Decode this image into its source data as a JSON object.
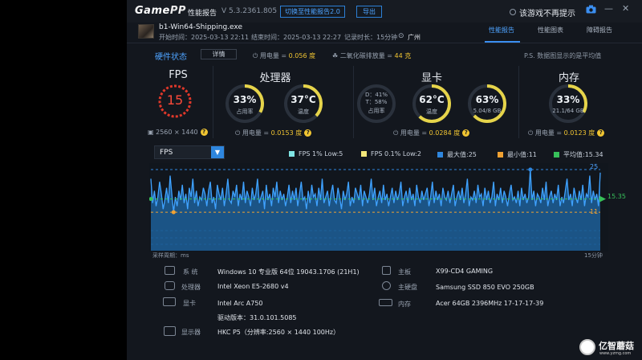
{
  "titlebar": {
    "logo_a": "Game",
    "logo_b": "PP",
    "title": "性能报告",
    "version": "V 5.3.2361.805",
    "switch_label": "切换至性能报告2.0",
    "export_label": "导出",
    "no_more_label": "该游戏不再提示"
  },
  "game": {
    "exe": "b1-Win64-Shipping.exe",
    "start": "开始时间：2025-03-13 22:11",
    "end": "结束时间：2025-03-13 22:27",
    "duration": "记录时长：15分钟",
    "location": "广州"
  },
  "tabs": [
    "性能报告",
    "性能图表",
    "障碍报告"
  ],
  "hw": {
    "title": "硬件状态",
    "detail_label": "详情",
    "power_label": "用电量 = ",
    "power_value": "0.056 度",
    "co2_label": "二氧化碳排放量 = ",
    "co2_value": "44 克",
    "ps": "P.S. 数据图显示的是平均值"
  },
  "fps_panel": {
    "title": "FPS",
    "value": "15",
    "resolution": "2560 × 1440"
  },
  "cpu_panel": {
    "title": "处理器",
    "usage_value": "33%",
    "usage_label": "占用率",
    "usage_pct": 33,
    "temp_value": "37°C",
    "temp_label": "温度",
    "temp_pct": 37,
    "power_label": "用电量 = ",
    "power_value": "0.0153 度"
  },
  "gpu_panel": {
    "title": "显卡",
    "d_label": "D：41%",
    "t_label": "T：58%",
    "usage_label": "占用率",
    "temp_value": "62°C",
    "temp_label": "温度",
    "temp_pct": 62,
    "vram_value": "63%",
    "vram_label": "5.04/8 GB",
    "vram_pct": 63,
    "power_label": "用电量 = ",
    "power_value": "0.0284 度"
  },
  "mem_panel": {
    "title": "内存",
    "usage_value": "33%",
    "usage_label": "21.1/64 GB",
    "usage_pct": 33,
    "power_label": "用电量 = ",
    "power_value": "0.0123 度"
  },
  "chart_data": {
    "type": "area",
    "selected_metric": "FPS",
    "legend": [
      {
        "label": "FPS 1% Low:5",
        "color": "#7fe3e3"
      },
      {
        "label": "FPS 0.1% Low:2",
        "color": "#f3e77a"
      },
      {
        "label": "最大值:25",
        "color": "#2e86de"
      },
      {
        "label": "最小值:11",
        "color": "#f0a132"
      },
      {
        "label": "平均值:15.34",
        "color": "#37c05a"
      }
    ],
    "max": 25,
    "min": 11,
    "avg": 15.34,
    "low1": 5,
    "low01": 2,
    "ylim": [
      0,
      25
    ],
    "max_label": "25",
    "min_label": "11",
    "avg_label": "15.35",
    "xlabel": "采样周期：ms",
    "duration_label": "15分钟",
    "values": [
      22,
      14,
      18,
      13,
      16,
      21,
      17,
      12,
      15,
      19,
      14,
      23,
      17,
      11,
      16,
      13,
      18,
      15,
      20,
      14,
      17,
      12,
      19,
      16,
      22,
      14,
      18,
      13,
      16,
      15,
      19,
      17,
      13,
      18,
      21,
      14,
      16,
      12,
      20,
      17,
      15,
      19,
      13,
      17,
      22,
      15,
      14,
      18,
      16,
      20,
      13,
      17,
      15,
      21,
      14,
      18,
      16,
      13,
      19,
      15,
      17,
      22,
      14,
      16,
      18,
      12,
      20,
      15,
      17,
      13,
      19,
      16,
      21,
      14,
      18,
      15,
      17,
      13,
      16,
      20,
      14,
      18,
      15,
      19,
      13,
      17,
      21,
      15,
      16,
      12,
      18,
      14,
      20,
      16,
      17,
      13,
      19,
      15,
      22,
      14,
      16,
      18,
      13,
      17,
      20,
      15,
      14,
      19,
      16,
      12,
      18,
      15,
      17,
      21,
      13,
      16,
      14,
      19,
      17,
      15,
      20,
      13,
      18,
      16,
      14,
      17,
      22,
      15,
      19,
      13,
      16,
      18,
      14,
      20,
      15,
      17,
      13,
      16,
      19,
      14,
      18,
      15,
      17,
      21,
      13,
      16,
      18,
      14,
      19,
      15,
      17,
      13,
      20,
      16,
      14,
      18,
      15,
      17,
      19,
      13,
      16,
      21,
      14,
      18,
      15,
      17,
      13,
      19,
      16,
      15,
      18,
      14,
      17,
      20,
      13,
      16,
      18,
      15,
      19,
      14,
      17,
      22,
      13,
      16,
      15,
      18,
      14,
      20,
      16,
      17,
      13,
      19,
      15,
      18,
      14,
      16,
      21,
      13,
      17,
      15,
      19,
      14,
      18,
      16,
      13,
      17,
      20,
      15,
      16,
      14,
      18,
      13,
      19,
      15,
      17,
      14,
      16,
      25,
      15,
      18,
      13,
      17,
      16,
      14,
      19,
      15,
      21,
      13,
      16,
      18,
      14,
      17,
      15,
      20,
      13,
      16,
      14,
      18,
      22,
      15,
      17,
      13,
      19,
      16,
      14,
      18,
      15,
      20,
      13,
      17,
      16,
      23,
      14,
      18,
      15,
      17,
      13,
      24
    ]
  },
  "sysinfo": {
    "system_label": "系 统",
    "system_value": "Windows 10 专业版 64位 19043.1706 (21H1)",
    "cpu_label": "处理器",
    "cpu_value": "Intel Xeon E5-2680 v4",
    "gpu_label": "显卡",
    "gpu_value": "Intel Arc A750",
    "driver_value": "驱动版本：31.0.101.5085",
    "display_label": "显示器",
    "display_value": "HKC P5（分辨率:2560 × 1440 100Hz）",
    "board_label": "主板",
    "board_value": "X99-CD4 GAMING",
    "disk_label": "主硬盘",
    "disk_value": "Samsung SSD 850 EVO 250GB",
    "mem_label": "内存",
    "mem_value": "Acer 64GB 2396MHz 17-17-17-39"
  },
  "watermark": {
    "text": "亿智蘑菇",
    "sub": "www.yzmg.com"
  }
}
